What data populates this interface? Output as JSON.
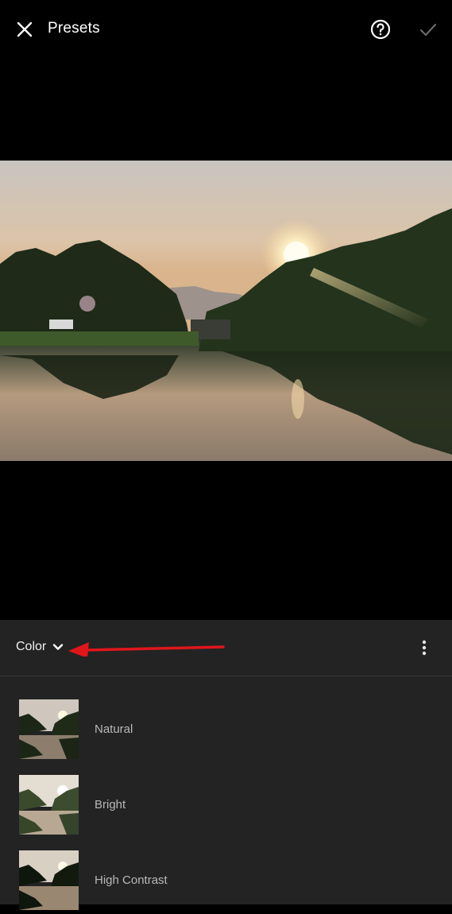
{
  "header": {
    "title": "Presets",
    "close_icon": "close-icon",
    "help_icon": "help-circle-icon",
    "confirm_icon": "checkmark-icon"
  },
  "photo": {
    "description_icon": "photo-preview"
  },
  "panel": {
    "category_label": "Color",
    "category_icon": "chevron-down-icon",
    "more_icon": "more-vertical-icon",
    "annotation_color": "#e0161b"
  },
  "presets": [
    {
      "label": "Natural"
    },
    {
      "label": "Bright"
    },
    {
      "label": "High Contrast"
    }
  ],
  "colors": {
    "background": "#000000",
    "panel": "#232323",
    "divider": "#3a3a3a",
    "preset_text": "#b8b8b8",
    "confirm_disabled": "#6a6a6a"
  }
}
